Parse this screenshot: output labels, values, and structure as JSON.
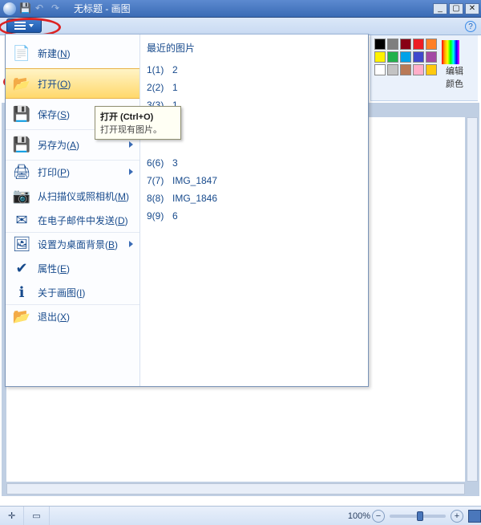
{
  "title": "无标题 - 画图",
  "ribbon": {
    "edit_colors": "编辑颜色",
    "palette": [
      "#000",
      "#7f7f7f",
      "#880015",
      "#ed1c24",
      "#ff7f27",
      "#fff200",
      "#22b14c",
      "#00a2e8",
      "#3f48cc",
      "#a349a4",
      "#fff",
      "#c3c3c3",
      "#b97a57",
      "#ffaec9",
      "#ffc90e"
    ]
  },
  "menu": {
    "items": [
      {
        "key": "new",
        "label": "新建(N)",
        "submenu": false,
        "hover": false
      },
      {
        "key": "open",
        "label": "打开(O)",
        "submenu": false,
        "hover": true
      },
      {
        "key": "save",
        "label": "保存(S)",
        "submenu": false,
        "hover": false
      },
      {
        "key": "saveas",
        "label": "另存为(A)",
        "submenu": true,
        "hover": false
      },
      {
        "key": "print",
        "label": "打印(P)",
        "submenu": true,
        "hover": false
      },
      {
        "key": "scanner",
        "label": "从扫描仪或照相机(M)",
        "submenu": false,
        "hover": false
      },
      {
        "key": "email",
        "label": "在电子邮件中发送(D)",
        "submenu": false,
        "hover": false
      },
      {
        "key": "wallpaper",
        "label": "设置为桌面背景(B)",
        "submenu": true,
        "hover": false
      },
      {
        "key": "props",
        "label": "属性(E)",
        "submenu": false,
        "hover": false
      },
      {
        "key": "about",
        "label": "关于画图(I)",
        "submenu": false,
        "hover": false
      },
      {
        "key": "exit",
        "label": "退出(X)",
        "submenu": false,
        "hover": false
      }
    ],
    "recent_title": "最近的图片",
    "recent": [
      {
        "n": "1(1)",
        "name": "2"
      },
      {
        "n": "2(2)",
        "name": "1"
      },
      {
        "n": "3(3)",
        "name": "1"
      },
      {
        "n": "6(6)",
        "name": "3"
      },
      {
        "n": "7(7)",
        "name": "IMG_1847"
      },
      {
        "n": "8(8)",
        "name": "IMG_1846"
      },
      {
        "n": "9(9)",
        "name": "6"
      }
    ]
  },
  "tooltip": {
    "title": "打开 (Ctrl+O)",
    "body": "打开现有图片。"
  },
  "status": {
    "zoom_label": "100%"
  }
}
